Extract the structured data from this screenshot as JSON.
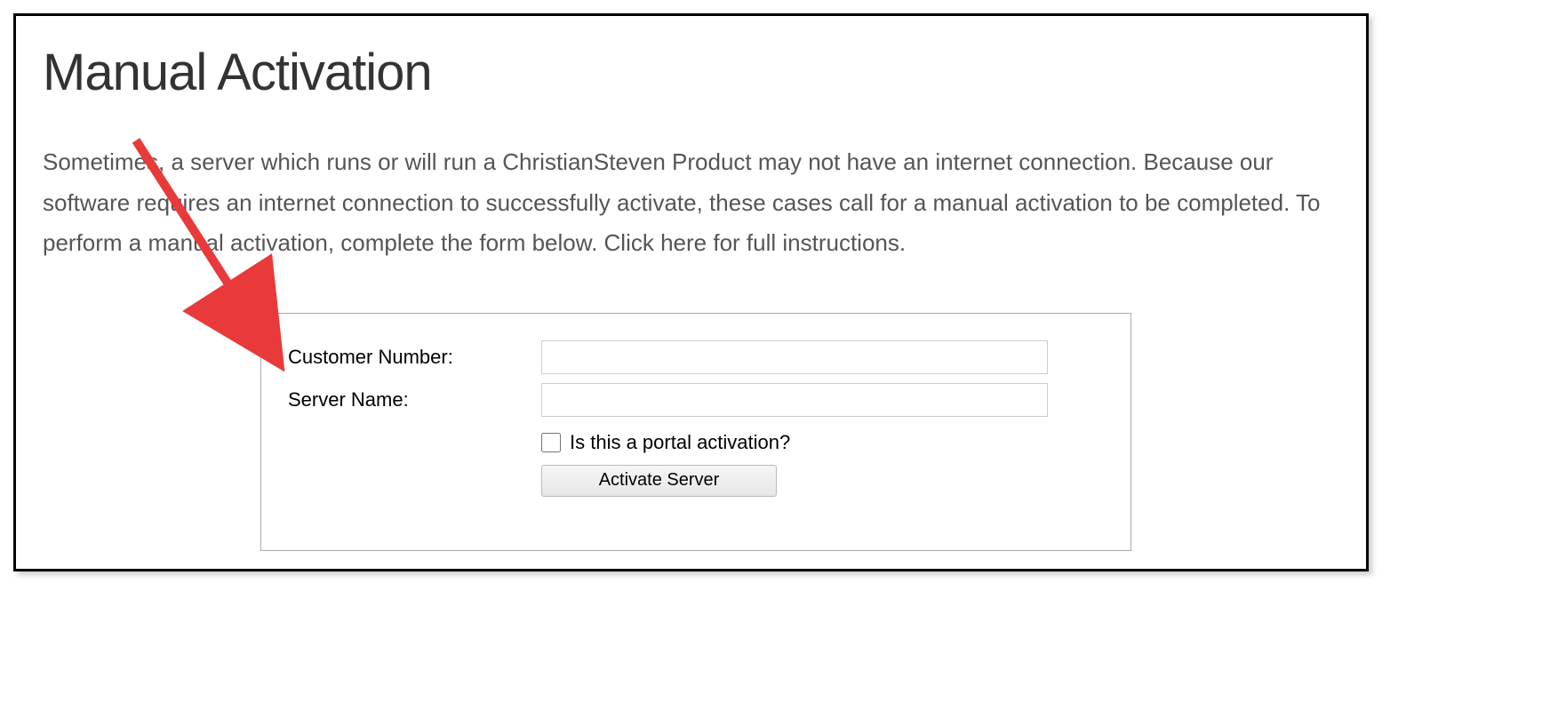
{
  "title": "Manual Activation",
  "description": "Sometimes, a server which runs or will run a ChristianSteven Product may not have an internet connection. Because our software requires an internet connection to successfully activate, these cases call for a manual activation to be completed. To perform a manual activation, complete the form below. Click here for full instructions.",
  "form": {
    "customer_number_label": "Customer Number:",
    "customer_number_value": "",
    "server_name_label": "Server Name:",
    "server_name_value": "",
    "portal_checkbox_label": "Is this a portal activation?",
    "activate_button_label": "Activate Server"
  }
}
